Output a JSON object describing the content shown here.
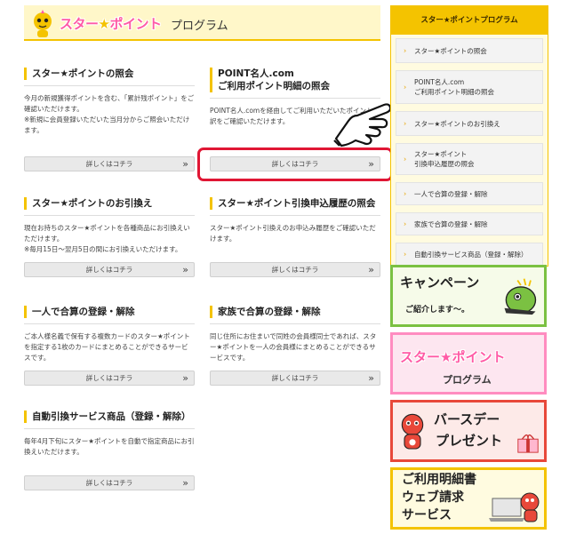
{
  "header": {
    "logo_prefix": "スター",
    "logo_star": "★",
    "logo_suffix": "ポイント",
    "subtitle": "プログラム"
  },
  "cards": [
    {
      "title_lines": [
        "スター★ポイントの照会"
      ],
      "body": [
        "今月の新規獲得ポイントを含む、「累計残ポイント」をご確認いただけます。",
        "※新規に会員登録いただいた当月分からご照会いただけます。"
      ],
      "button": "詳しくはコチラ"
    },
    {
      "title_lines": [
        "POINT名人.com",
        "ご利用ポイント明細の照会"
      ],
      "body": [
        "POINT名人.comを経由してご利用いただいたポイント内訳をご確認いただけます。"
      ],
      "button": "詳しくはコチラ"
    },
    {
      "title_lines": [
        "スター★ポイントのお引換え"
      ],
      "body": [
        "現在お持ちのスター★ポイントを各種商品にお引換えいただけます。",
        "※毎月15日～翌月5日の間にお引換えいただけます。"
      ],
      "button": "詳しくはコチラ"
    },
    {
      "title_lines": [
        "スター★ポイント引換申込履歴の照会"
      ],
      "body": [
        "スター★ポイント引換えのお申込み履歴をご確認いただけます。"
      ],
      "button": "詳しくはコチラ"
    },
    {
      "title_lines": [
        "一人で合算の登録・解除"
      ],
      "body": [
        "ご本人様名義で保有する複数カードのスター★ポイントを指定する1枚のカードにまとめることができるサービスです。"
      ],
      "button": "詳しくはコチラ"
    },
    {
      "title_lines": [
        "家族で合算の登録・解除"
      ],
      "body": [
        "同じ住所にお住まいで同姓の会員様同士であれば、スター★ポイントを一人の会員様にまとめることができるサービスです。"
      ],
      "button": "詳しくはコチラ"
    },
    {
      "title_lines": [
        "自動引換サービス商品（登録・解除）"
      ],
      "body": [
        "毎年4月下旬にスター★ポイントを自動で指定商品にお引換えいただけます。"
      ],
      "button": "詳しくはコチラ"
    }
  ],
  "button_chevron": "»",
  "sidebar": {
    "title": "スター★ポイントプログラム",
    "items": [
      {
        "lines": [
          "スター★ポイントの照会"
        ]
      },
      {
        "lines": [
          "POINT名人.com",
          "ご利用ポイント明細の照会"
        ]
      },
      {
        "lines": [
          "スター★ポイントのお引換え"
        ]
      },
      {
        "lines": [
          "スター★ポイント",
          "引換申込履歴の照会"
        ]
      },
      {
        "lines": [
          "一人で合算の登録・解除"
        ]
      },
      {
        "lines": [
          "家族で合算の登録・解除"
        ]
      },
      {
        "lines": [
          "自動引換サービス商品（登録・解除）"
        ]
      }
    ],
    "arrow": "›"
  },
  "banners": {
    "campaign": {
      "title": "キャンペーン",
      "sub": "ご紹介します～。"
    },
    "program": {
      "title": "スター★ポイント",
      "sub": "プログラム"
    },
    "birthday": {
      "title": "バースデー",
      "sub": "プレゼント"
    },
    "billing": {
      "line1": "ご利用明細書",
      "line2": "ウェブ請求",
      "line3": "サービス"
    }
  },
  "colors": {
    "accent": "#f4c300",
    "pink": "#ff5aa5",
    "highlight": "#e01634",
    "green": "#7bc142",
    "red": "#e8483a"
  }
}
